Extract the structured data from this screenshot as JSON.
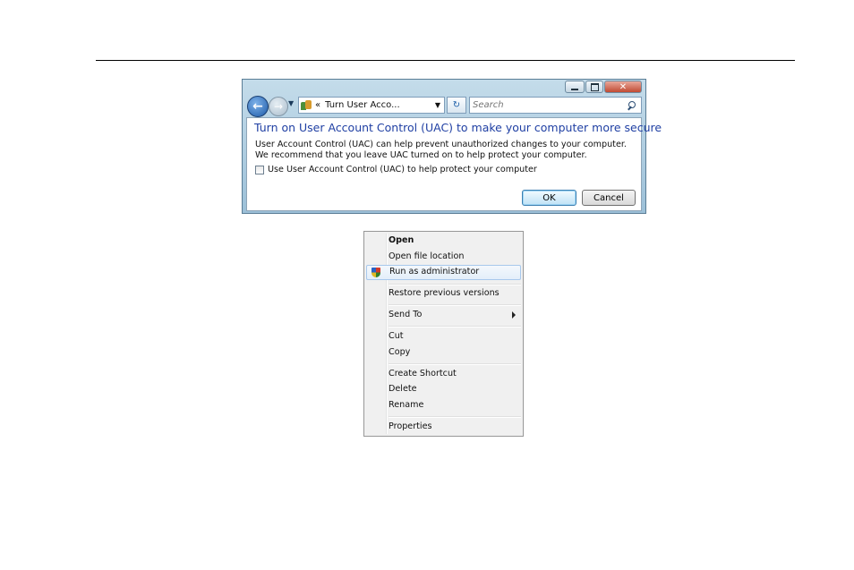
{
  "uac_window": {
    "address_text": "Turn User Acco...",
    "address_prefix": "«",
    "search_placeholder": "Search",
    "heading": "Turn on User Account Control (UAC) to make your computer more secure",
    "description": "User Account Control (UAC) can help prevent unauthorized changes to your computer.  We recommend that you leave UAC turned on to help protect your computer.",
    "checkbox_label": "Use User Account Control (UAC) to help protect your computer",
    "checkbox_checked": false,
    "ok_label": "OK",
    "cancel_label": "Cancel"
  },
  "context_menu": {
    "open": "Open",
    "open_file_location": "Open file location",
    "run_as_administrator": "Run as administrator",
    "restore_previous_versions": "Restore previous versions",
    "send_to": "Send To",
    "cut": "Cut",
    "copy": "Copy",
    "create_shortcut": "Create Shortcut",
    "delete": "Delete",
    "rename": "Rename",
    "properties": "Properties"
  },
  "icons": {
    "back": "back-arrow-icon",
    "forward": "forward-arrow-icon",
    "search": "search-icon",
    "uac_shield": "uac-shield-icon",
    "submenu": "chevron-right-icon"
  },
  "colors": {
    "heading": "#1f3fa3",
    "window_frame": "#9cc0d8",
    "menu_background": "#f0f0f0"
  }
}
